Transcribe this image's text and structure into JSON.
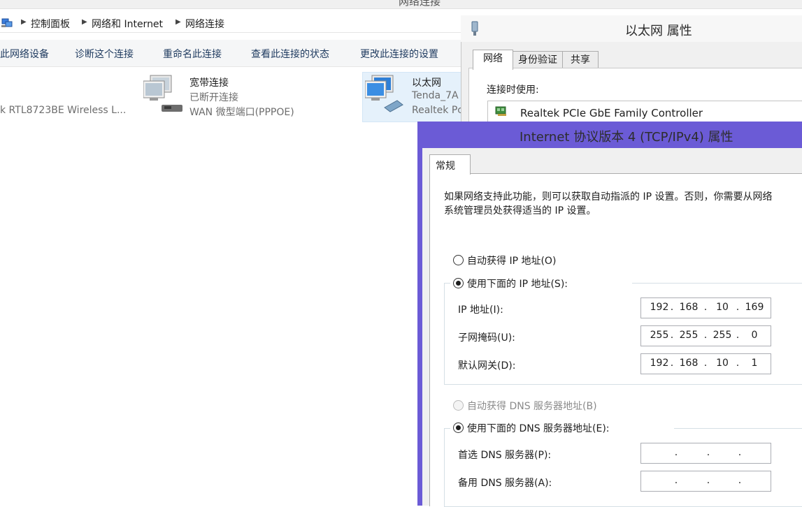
{
  "explorer": {
    "title": "网络连接",
    "breadcrumb": [
      "控制面板",
      "网络和 Internet",
      "网络连接"
    ],
    "commands": [
      "此网络设备",
      "诊断这个连接",
      "重命名此连接",
      "查看此连接的状态",
      "更改此连接的设置"
    ],
    "connections": [
      {
        "title": "",
        "status": "",
        "device": "k RTL8723BE Wireless L..."
      },
      {
        "title": "宽带连接",
        "status": "已断开连接",
        "device": "WAN 微型端口(PPPOE)"
      },
      {
        "title": "以太网",
        "status": "Tenda_7A",
        "device": "Realtek Pc"
      }
    ]
  },
  "ethernet_props": {
    "title": "以太网 属性",
    "tabs": [
      "网络",
      "身份验证",
      "共享"
    ],
    "connect_using_label": "连接时使用:",
    "adapter_name": "Realtek PCIe GbE Family Controller"
  },
  "ipv4_dialog": {
    "title": "Internet 协议版本 4 (TCP/IPv4) 属性",
    "tab": "常规",
    "description_line1": "如果网络支持此功能，则可以获取自动指派的 IP 设置。否则，你需要从网络",
    "description_line2": "系统管理员处获得适当的 IP 设置。",
    "auto_ip_label": "自动获得 IP 地址(O)",
    "manual_ip_label": "使用下面的 IP 地址(S):",
    "ip_label": "IP 地址(I):",
    "ip_value": [
      "192",
      "168",
      "10",
      "169"
    ],
    "subnet_label": "子网掩码(U):",
    "subnet_value": [
      "255",
      "255",
      "255",
      "0"
    ],
    "gateway_label": "默认网关(D):",
    "gateway_value": [
      "192",
      "168",
      "10",
      "1"
    ],
    "auto_dns_label": "自动获得 DNS 服务器地址(B)",
    "manual_dns_label": "使用下面的 DNS 服务器地址(E):",
    "preferred_dns_label": "首选 DNS 服务器(P):",
    "preferred_dns_value": [
      "",
      "",
      "",
      ""
    ],
    "alternate_dns_label": "备用 DNS 服务器(A):",
    "alternate_dns_value": [
      "",
      "",
      "",
      ""
    ],
    "ip_mode": "manual",
    "dns_mode": "manual"
  },
  "colors": {
    "dialog_frame": "#6b5bd6",
    "selection": "#e5f1fb"
  }
}
